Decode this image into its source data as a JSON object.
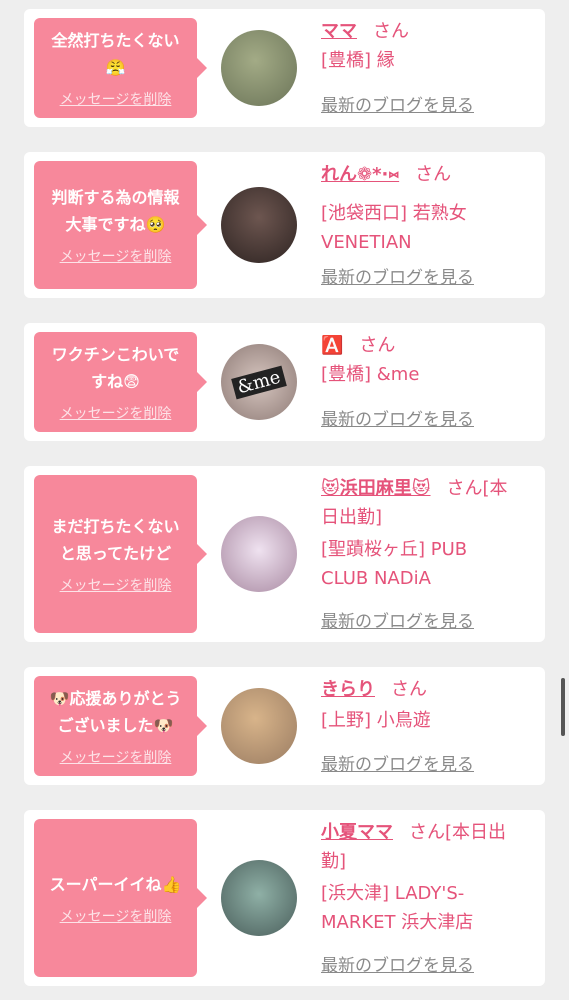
{
  "items": [
    {
      "message": "全然打ちたくない\n😤",
      "delete_label": "メッセージを削除",
      "name": "ママ",
      "san": "さん",
      "shop_lines": [
        "[豊橋] 縁"
      ],
      "blog_label": "最新のブログを見る",
      "avatar_color": "#8a9270"
    },
    {
      "message": "判断する為の情報\n大事ですね🥺",
      "delete_label": "メッセージを削除",
      "name": "れん❁*·⑅",
      "san": "さん",
      "shop_lines": [
        "[池袋西口] 若熟女",
        "VENETIAN"
      ],
      "blog_label": "最新のブログを見る",
      "avatar_color": "#4a3a36"
    },
    {
      "message": "ワクチンこわいで\nすね😨",
      "delete_label": "メッセージを削除",
      "name": "🅰️",
      "san": "さん",
      "shop_lines": [
        "[豊橋] &me"
      ],
      "blog_label": "最新のブログを見る",
      "avatar_color": "#b8a59e",
      "avatar_text": "&me"
    },
    {
      "message": "まだ打ちたくない\nと思ってたけど",
      "delete_label": "メッセージを削除",
      "name": "😻浜田麻里😻",
      "san": "さん[本",
      "shop_lines": [
        "日出勤]",
        "[聖蹟桜ヶ丘] PUB",
        "CLUB NADiA"
      ],
      "blog_label": "最新のブログを見る",
      "avatar_color": "#d9b8c8"
    },
    {
      "message": "🐶応援ありがとう\nございました🐶",
      "delete_label": "メッセージを削除",
      "name": "きらり",
      "san": "さん",
      "shop_lines": [
        "[上野] 小鳥遊"
      ],
      "blog_label": "最新のブログを見る",
      "avatar_color": "#c9a37a"
    },
    {
      "message": "スーパーイイね👍",
      "delete_label": "メッセージを削除",
      "name": "小夏ママ",
      "san": "さん[本日出",
      "shop_lines": [
        "勤]",
        "[浜大津] LADY'S-",
        "MARKET 浜大津店"
      ],
      "blog_label": "最新のブログを見る",
      "avatar_color": "#6f8a86"
    }
  ]
}
